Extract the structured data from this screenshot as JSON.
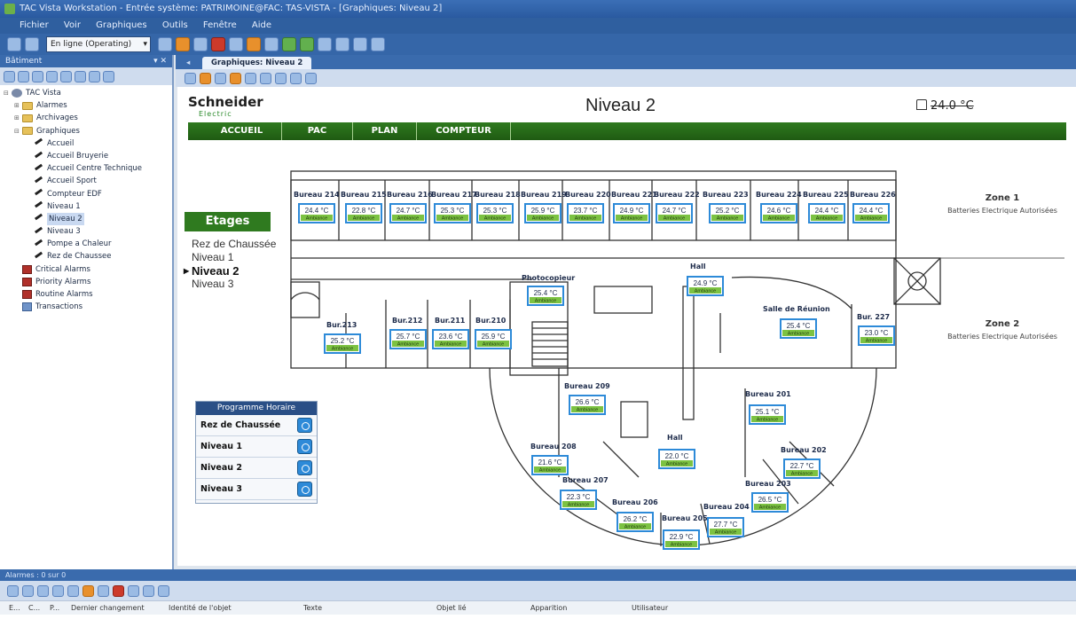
{
  "window": {
    "title": "TAC Vista Workstation - Entrée système: PATRIMOINE@FAC: TAS-VISTA - [Graphiques: Niveau 2]"
  },
  "menu": [
    "Fichier",
    "Voir",
    "Graphiques",
    "Outils",
    "Fenêtre",
    "Aide"
  ],
  "toolbar": {
    "mode_select": "En ligne (Operating)"
  },
  "left_pane": {
    "header": "Bâtiment",
    "tree": [
      {
        "label": "TAC Vista",
        "level": 0,
        "icon": "root-icon"
      },
      {
        "label": "Alarmes",
        "level": 1,
        "icon": "folder-icon"
      },
      {
        "label": "Archivages",
        "level": 1,
        "icon": "folder-icon"
      },
      {
        "label": "Graphiques",
        "level": 1,
        "icon": "folder-icon"
      },
      {
        "label": "Accueil",
        "level": 2,
        "icon": "graphic-icon"
      },
      {
        "label": "Accueil Bruyerie",
        "level": 2,
        "icon": "graphic-icon"
      },
      {
        "label": "Accueil Centre Technique",
        "level": 2,
        "icon": "graphic-icon"
      },
      {
        "label": "Accueil Sport",
        "level": 2,
        "icon": "graphic-icon"
      },
      {
        "label": "Compteur EDF",
        "level": 2,
        "icon": "graphic-icon"
      },
      {
        "label": "Niveau 1",
        "level": 2,
        "icon": "graphic-icon"
      },
      {
        "label": "Niveau 2",
        "level": 2,
        "icon": "graphic-icon"
      },
      {
        "label": "Niveau 3",
        "level": 2,
        "icon": "graphic-icon"
      },
      {
        "label": "Pompe a Chaleur",
        "level": 2,
        "icon": "graphic-icon"
      },
      {
        "label": "Rez de Chaussee",
        "level": 2,
        "icon": "graphic-icon"
      },
      {
        "label": "Critical Alarms",
        "level": 1,
        "icon": "alarm-icon"
      },
      {
        "label": "Priority Alarms",
        "level": 1,
        "icon": "alarm-icon"
      },
      {
        "label": "Routine Alarms",
        "level": 1,
        "icon": "alarm-icon"
      },
      {
        "label": "Transactions",
        "level": 1,
        "icon": "list-icon"
      }
    ]
  },
  "doc_tab": "Graphiques: Niveau 2",
  "graphic": {
    "logo": "Schneider",
    "logo_sub": "Electric",
    "title": "Niveau 2",
    "outdoor_temp": "24.0 °C",
    "nav": [
      "ACCUEIL",
      "PAC",
      "PLAN",
      "COMPTEUR"
    ],
    "etages_label": "Etages",
    "levels": [
      "Rez de Chaussée",
      "Niveau 1",
      "Niveau 2",
      "Niveau 3"
    ],
    "current_level": "Niveau 2",
    "schedule": {
      "title": "Programme Horaire",
      "rows": [
        "Rez de Chaussée",
        "Niveau 1",
        "Niveau 2",
        "Niveau 3"
      ]
    },
    "ambiance_label": "Ambiance",
    "zones": [
      {
        "title": "Zone 1",
        "subtitle": "Batteries Electrique Autorisées"
      },
      {
        "title": "Zone 2",
        "subtitle": "Batteries Electrique Autorisées"
      }
    ],
    "rooms": [
      {
        "name": "Bureau 214",
        "temp": "24.4 °C"
      },
      {
        "name": "Bureau 215",
        "temp": "22.8 °C"
      },
      {
        "name": "Bureau 216",
        "temp": "24.7 °C"
      },
      {
        "name": "Bureau 217",
        "temp": "25.3 °C"
      },
      {
        "name": "Bureau 218",
        "temp": "25.3 °C"
      },
      {
        "name": "Bureau 219",
        "temp": "25.9 °C"
      },
      {
        "name": "Bureau 220",
        "temp": "23.7 °C"
      },
      {
        "name": "Bureau 221",
        "temp": "24.9 °C"
      },
      {
        "name": "Bureau 222",
        "temp": "24.7 °C"
      },
      {
        "name": "Bureau 223",
        "temp": "25.2 °C"
      },
      {
        "name": "Bureau 224",
        "temp": "24.6 °C"
      },
      {
        "name": "Bureau 225",
        "temp": "24.4 °C"
      },
      {
        "name": "Bureau 226",
        "temp": "24.4 °C"
      },
      {
        "name": "Photocopieur",
        "temp": "25.4 °C"
      },
      {
        "name": "Hall",
        "temp": "24.9 °C"
      },
      {
        "name": "Salle de Réunion",
        "temp": "25.4 °C"
      },
      {
        "name": "Bur. 227",
        "temp": "23.0 °C"
      },
      {
        "name": "Bur.213",
        "temp": "25.2 °C"
      },
      {
        "name": "Bur.212",
        "temp": "25.7 °C"
      },
      {
        "name": "Bur.211",
        "temp": "23.6 °C"
      },
      {
        "name": "Bur.210",
        "temp": "25.9 °C"
      },
      {
        "name": "Bureau 209",
        "temp": "26.6 °C"
      },
      {
        "name": "Bureau 201",
        "temp": "25.1 °C"
      },
      {
        "name": "Hall",
        "temp": "22.0 °C"
      },
      {
        "name": "Bureau 208",
        "temp": "21.6 °C"
      },
      {
        "name": "Bureau 202",
        "temp": "22.7 °C"
      },
      {
        "name": "Bureau 207",
        "temp": "22.3 °C"
      },
      {
        "name": "Bureau 203",
        "temp": "26.5 °C"
      },
      {
        "name": "Bureau 206",
        "temp": "26.2 °C"
      },
      {
        "name": "Bureau 205",
        "temp": "22.9 °C"
      },
      {
        "name": "Bureau 204",
        "temp": "27.7 °C"
      }
    ]
  },
  "alarms": {
    "header": "Alarmes : 0 sur 0",
    "columns": [
      "E...",
      "C...",
      "P...",
      "Dernier changement",
      "Identité de l'objet",
      "Texte",
      "Objet lié",
      "Apparition",
      "Utilisateur"
    ]
  },
  "colors": {
    "green_nav": "#2f7a1f",
    "temp_box_border": "#2d8ad8",
    "ambiance_green": "#7cc242",
    "ui_blue": "#3a6bad"
  }
}
